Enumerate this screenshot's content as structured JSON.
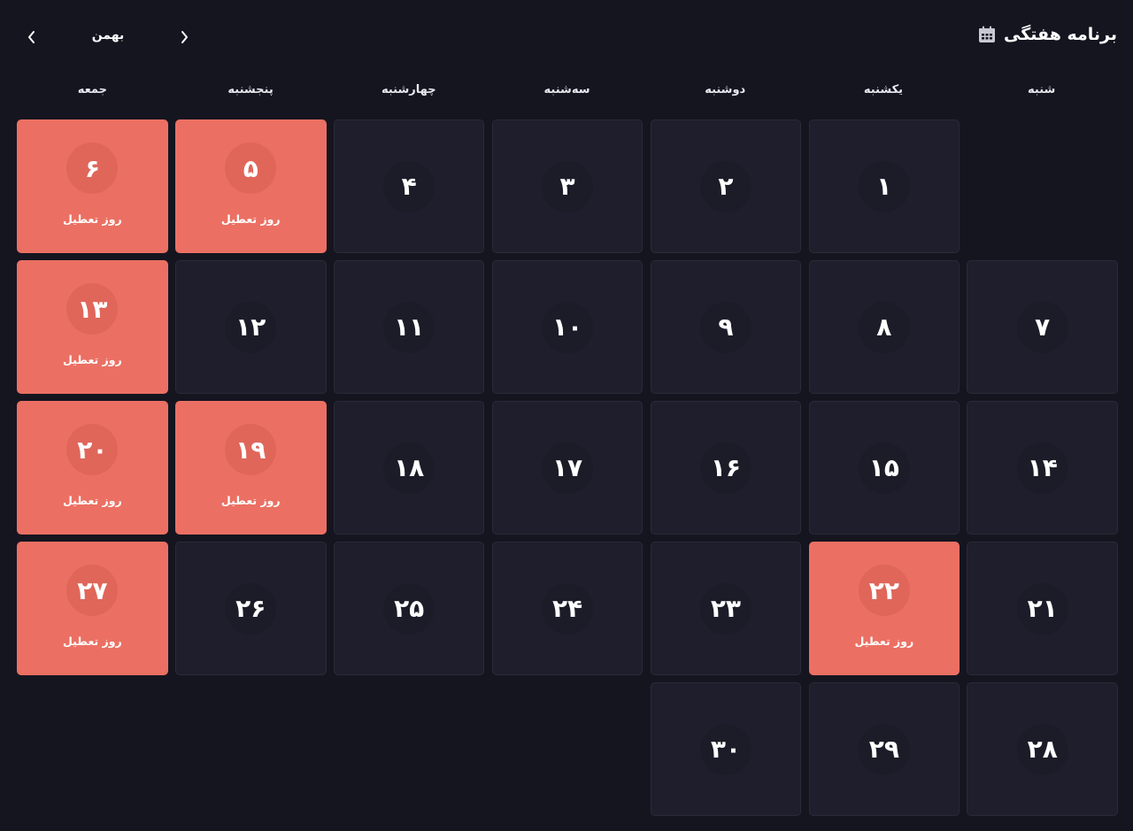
{
  "header": {
    "title": "برنامه هفتگی",
    "icon": "calendar-icon",
    "month": "بهمن",
    "prev_icon": "chevron-left-icon",
    "next_icon": "chevron-right-icon"
  },
  "weekdays": [
    "شنبه",
    "یکشنبه",
    "دوشنبه",
    "سه‌شنبه",
    "چهارشنبه",
    "پنجشنبه",
    "جمعه"
  ],
  "holiday_label": "روز تعطیل",
  "start_offset": 1,
  "days": [
    {
      "num": "۱",
      "holiday": false
    },
    {
      "num": "۲",
      "holiday": false
    },
    {
      "num": "۳",
      "holiday": false
    },
    {
      "num": "۴",
      "holiday": false
    },
    {
      "num": "۵",
      "holiday": true
    },
    {
      "num": "۶",
      "holiday": true
    },
    {
      "num": "۷",
      "holiday": false
    },
    {
      "num": "۸",
      "holiday": false
    },
    {
      "num": "۹",
      "holiday": false
    },
    {
      "num": "۱۰",
      "holiday": false
    },
    {
      "num": "۱۱",
      "holiday": false
    },
    {
      "num": "۱۲",
      "holiday": false
    },
    {
      "num": "۱۳",
      "holiday": true
    },
    {
      "num": "۱۴",
      "holiday": false
    },
    {
      "num": "۱۵",
      "holiday": false
    },
    {
      "num": "۱۶",
      "holiday": false
    },
    {
      "num": "۱۷",
      "holiday": false
    },
    {
      "num": "۱۸",
      "holiday": false
    },
    {
      "num": "۱۹",
      "holiday": true
    },
    {
      "num": "۲۰",
      "holiday": true
    },
    {
      "num": "۲۱",
      "holiday": false
    },
    {
      "num": "۲۲",
      "holiday": true
    },
    {
      "num": "۲۳",
      "holiday": false
    },
    {
      "num": "۲۴",
      "holiday": false
    },
    {
      "num": "۲۵",
      "holiday": false
    },
    {
      "num": "۲۶",
      "holiday": false
    },
    {
      "num": "۲۷",
      "holiday": true
    },
    {
      "num": "۲۸",
      "holiday": false
    },
    {
      "num": "۲۹",
      "holiday": false
    },
    {
      "num": "۳۰",
      "holiday": false
    }
  ],
  "colors": {
    "background": "#151520",
    "cell": "#1e1e2c",
    "holiday": "#eb7063",
    "text": "#ffffff"
  }
}
